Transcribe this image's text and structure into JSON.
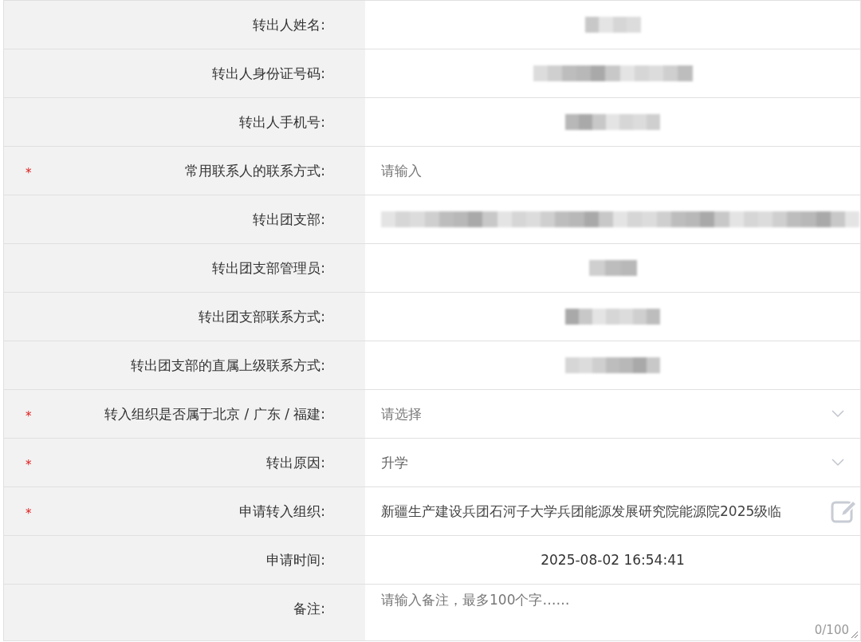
{
  "form": {
    "rows": [
      {
        "label": "转出人姓名:",
        "kind": "redacted"
      },
      {
        "label": "转出人身份证号码:",
        "kind": "redacted"
      },
      {
        "label": "转出人手机号:",
        "kind": "redacted"
      },
      {
        "label": "常用联系人的联系方式:",
        "kind": "input",
        "required_mark": "*",
        "placeholder": "请输入"
      },
      {
        "label": "转出团支部:",
        "kind": "redacted"
      },
      {
        "label": "转出团支部管理员:",
        "kind": "redacted"
      },
      {
        "label": "转出团支部联系方式:",
        "kind": "redacted"
      },
      {
        "label": "转出团支部的直属上级联系方式:",
        "kind": "redacted"
      },
      {
        "label": "转入组织是否属于北京 / 广东 / 福建:",
        "kind": "select",
        "required_mark": "*",
        "placeholder": "请选择"
      },
      {
        "label": "转出原因:",
        "kind": "select",
        "required_mark": "*",
        "value": "升学"
      },
      {
        "label": "申请转入组织:",
        "kind": "picker",
        "required_mark": "*",
        "value": "新疆生产建设兵团石河子大学兵团能源发展研究院能源院2025级临"
      },
      {
        "label": "申请时间:",
        "kind": "text",
        "value": "2025-08-02 16:54:41"
      },
      {
        "label": "备注:",
        "kind": "textarea",
        "placeholder": "请输入备注，最多100个字……",
        "counter": "0/100"
      }
    ]
  }
}
